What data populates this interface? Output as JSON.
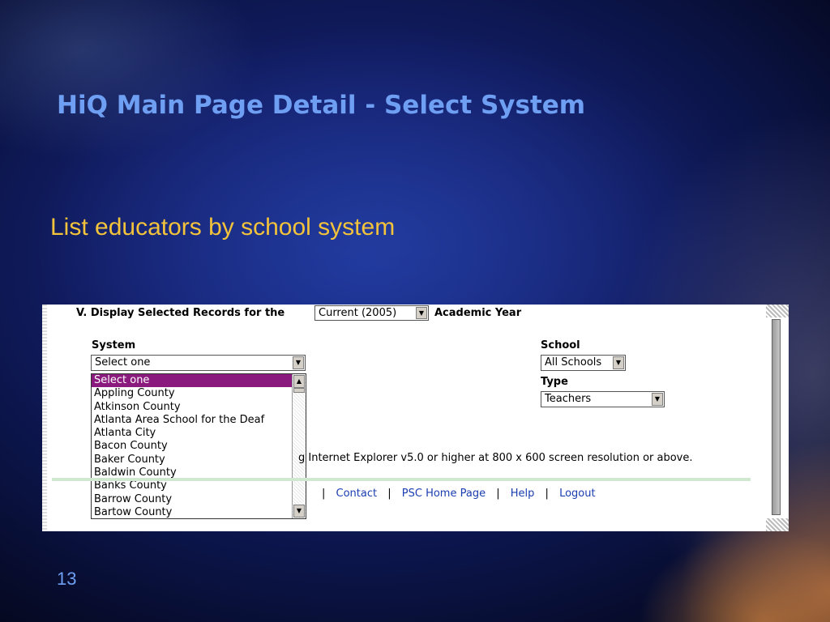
{
  "slide": {
    "title": "HiQ Main Page Detail - Select System",
    "subtitle": "List educators by school system",
    "page_number": "13"
  },
  "screenshot": {
    "header_prefix": "V. Display Selected Records for the",
    "year_select": "Current (2005)",
    "header_suffix": "Academic Year",
    "system_label": "System",
    "system_value": "Select one",
    "system_options": [
      "Select one",
      "Appling County",
      "Atkinson County",
      "Atlanta Area School for the Deaf",
      "Atlanta City",
      "Bacon County",
      "Baker County",
      "Baldwin County",
      "Banks County",
      "Barrow County",
      "Bartow County"
    ],
    "school_label": "School",
    "school_value": "All Schools",
    "type_label": "Type",
    "type_value": "Teachers",
    "note_text": "g Internet Explorer v5.0 or higher at 800 x 600 screen resolution or above.",
    "footer_links": [
      "Contact",
      "PSC Home Page",
      "Help",
      "Logout"
    ],
    "separator": "|"
  },
  "colors": {
    "title": "#6f9ff3",
    "subtitle": "#f3c33b",
    "selected_option": "#8b1a7e",
    "link": "#1a3db0"
  }
}
